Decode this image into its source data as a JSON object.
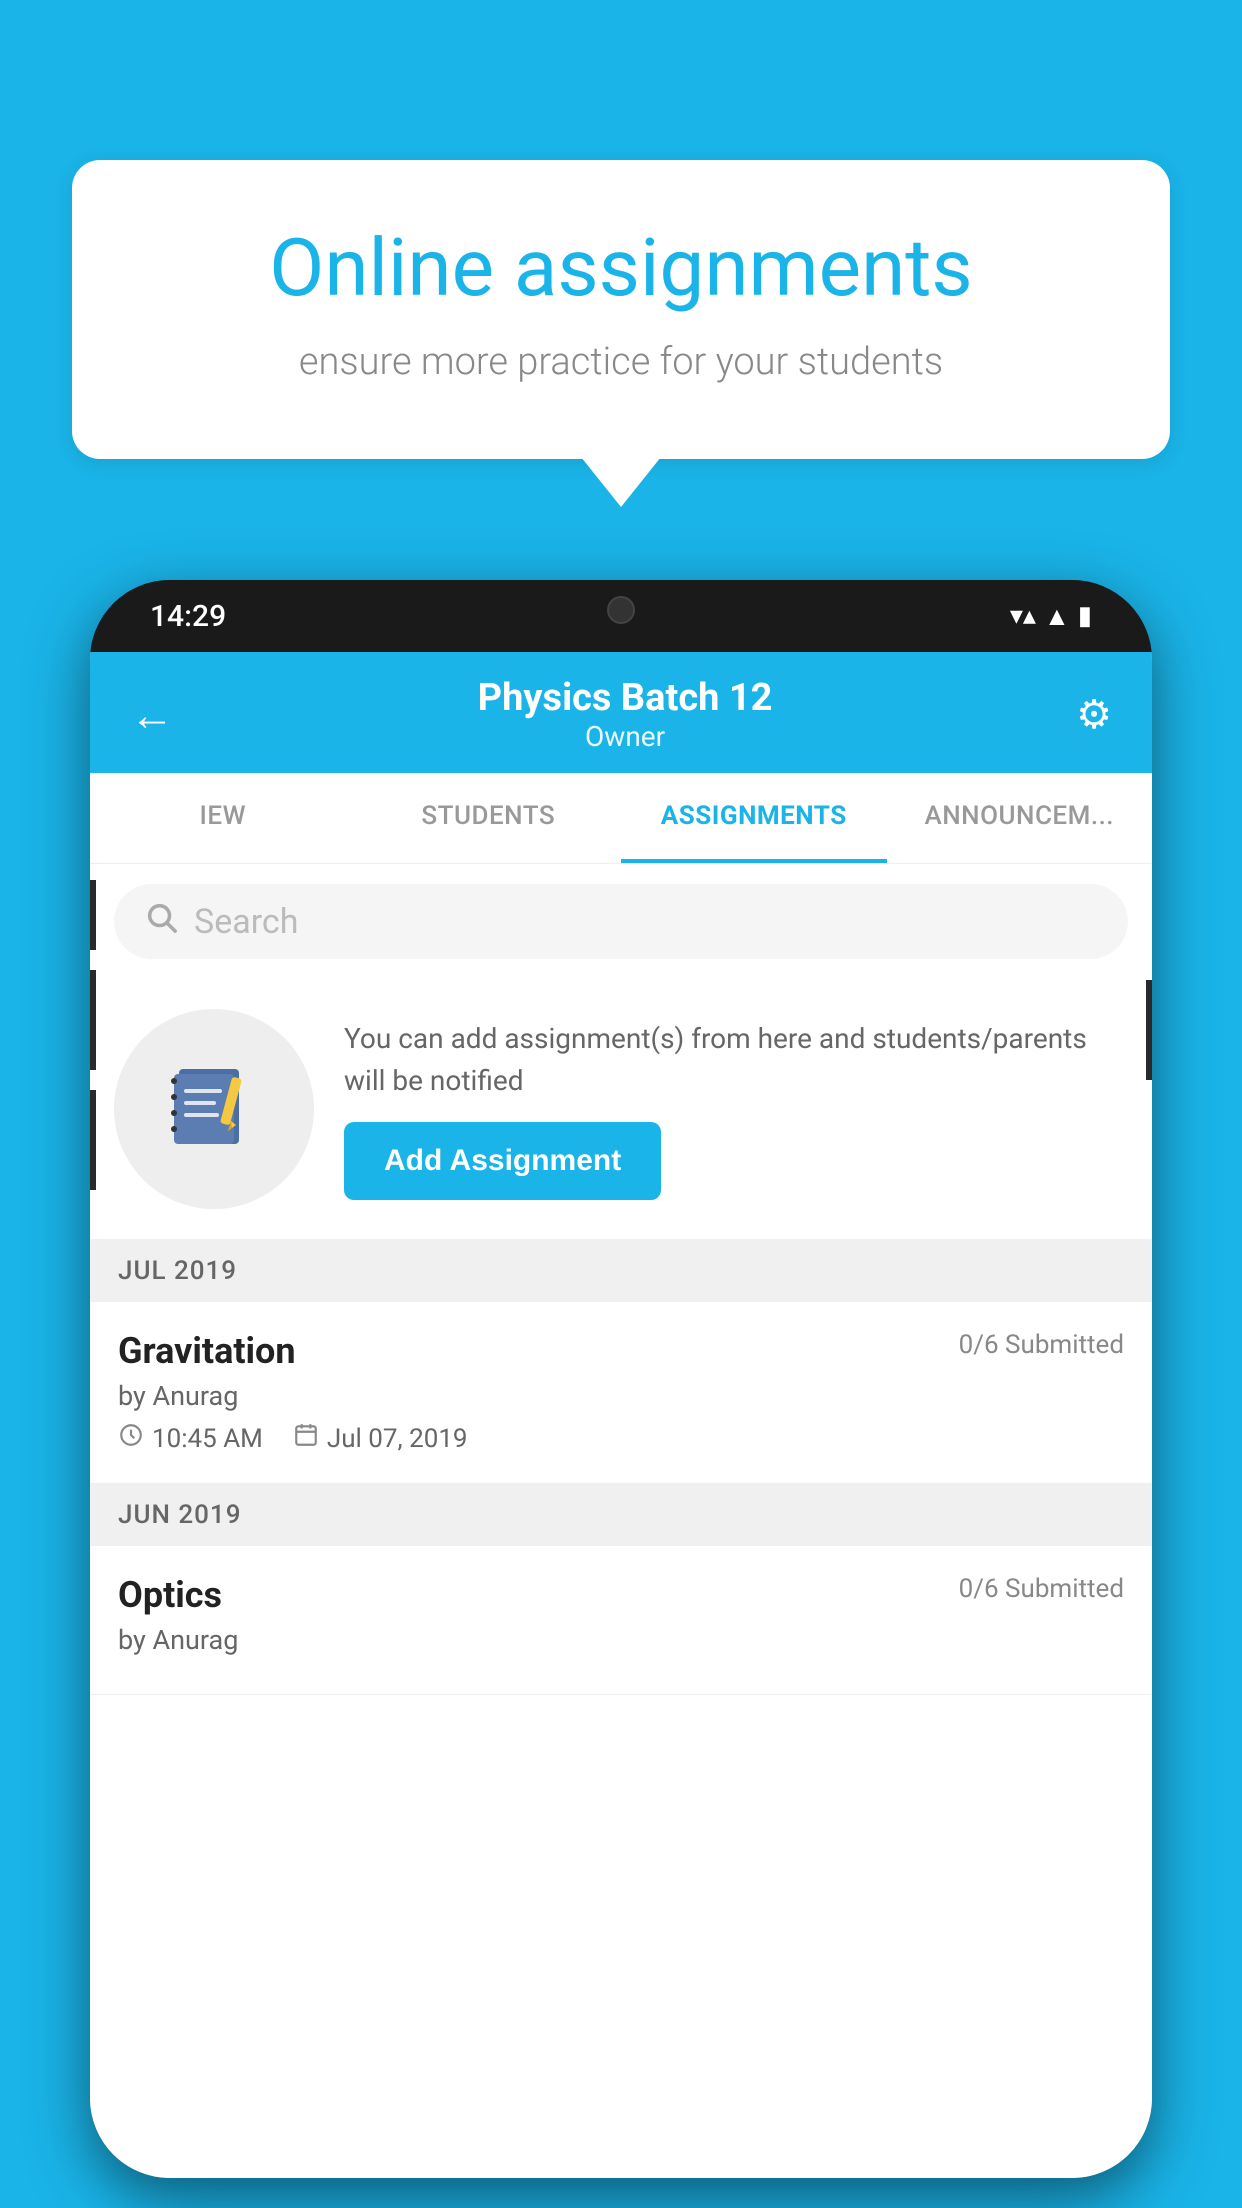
{
  "background_color": "#1ab4e8",
  "speech_bubble": {
    "title": "Online assignments",
    "subtitle": "ensure more practice for your students"
  },
  "phone": {
    "status_bar": {
      "time": "14:29",
      "wifi": "▼",
      "signal": "▲",
      "battery": "▮"
    },
    "header": {
      "title": "Physics Batch 12",
      "subtitle": "Owner",
      "back_label": "←",
      "settings_label": "⚙"
    },
    "tabs": [
      {
        "label": "IEW",
        "active": false
      },
      {
        "label": "STUDENTS",
        "active": false
      },
      {
        "label": "ASSIGNMENTS",
        "active": true
      },
      {
        "label": "ANNOUNCEM...",
        "active": false
      }
    ],
    "search": {
      "placeholder": "Search"
    },
    "promo": {
      "description": "You can add assignment(s) from here and students/parents will be notified",
      "button_label": "Add Assignment"
    },
    "months": [
      {
        "label": "JUL 2019",
        "assignments": [
          {
            "title": "Gravitation",
            "submitted": "0/6 Submitted",
            "author": "by Anurag",
            "time": "10:45 AM",
            "date": "Jul 07, 2019"
          }
        ]
      },
      {
        "label": "JUN 2019",
        "assignments": [
          {
            "title": "Optics",
            "submitted": "0/6 Submitted",
            "author": "by Anurag",
            "time": "",
            "date": ""
          }
        ]
      }
    ]
  }
}
